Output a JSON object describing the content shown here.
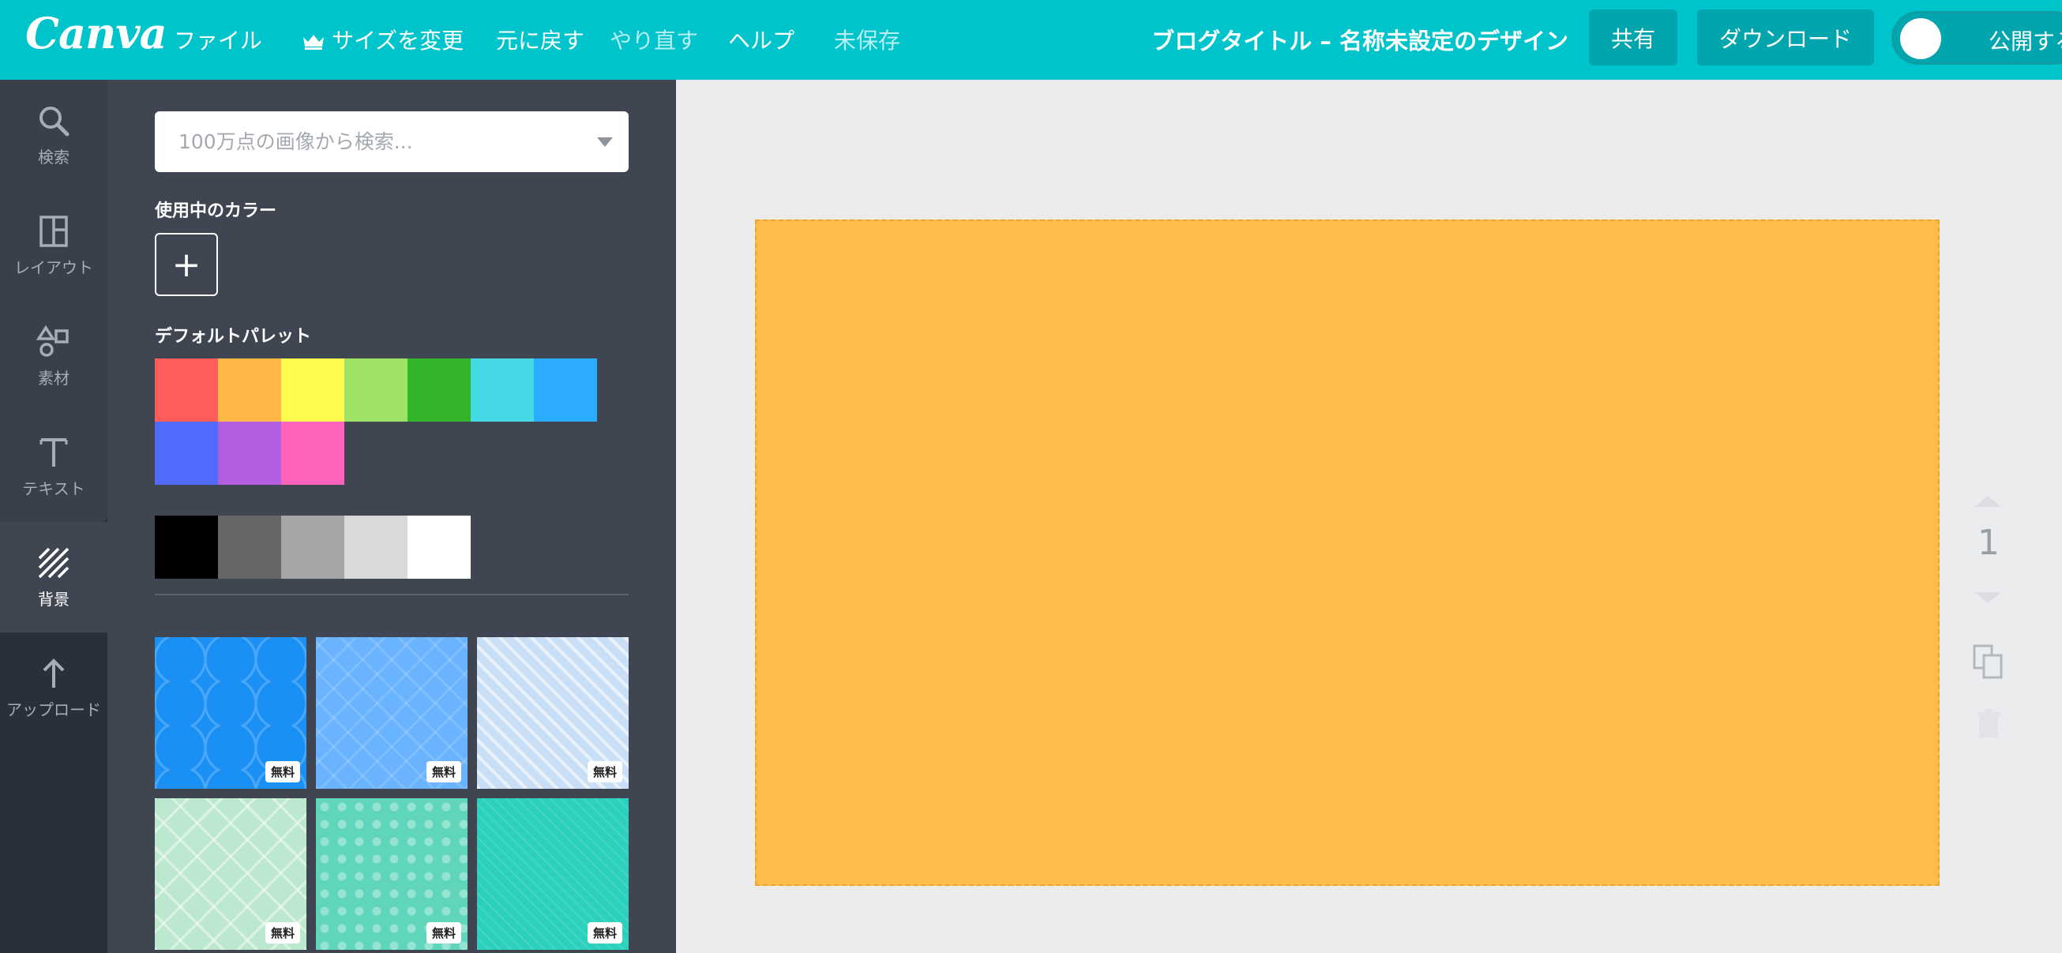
{
  "app": {
    "logo": "Canva"
  },
  "topbar": {
    "file": "ファイル",
    "resize": "サイズを変更",
    "undo": "元に戻す",
    "redo": "やり直す",
    "help": "ヘルプ",
    "save_status": "未保存",
    "doc_title": "ブログタイトル – 名称未設定のデザイン",
    "share": "共有",
    "download": "ダウンロード",
    "publish_toggle": "公開する"
  },
  "rail": {
    "items": [
      {
        "label": "検索",
        "icon": "search-icon"
      },
      {
        "label": "レイアウト",
        "icon": "layout-icon"
      },
      {
        "label": "素材",
        "icon": "elements-icon"
      },
      {
        "label": "テキスト",
        "icon": "text-icon"
      },
      {
        "label": "背景",
        "icon": "background-icon"
      },
      {
        "label": "アップロード",
        "icon": "upload-icon"
      }
    ],
    "active": "背景"
  },
  "panel": {
    "search_placeholder": "100万点の画像から検索...",
    "in_use_label": "使用中のカラー",
    "add_color": "+",
    "default_palette_label": "デフォルトパレット",
    "palette_colors": [
      "#ff5c5c",
      "#ffb845",
      "#fffb4f",
      "#9ee365",
      "#34b42b",
      "#44d9e4",
      "#2bacff",
      "#526bff",
      "#b35de0",
      "#ff63bb"
    ],
    "gray_colors": [
      "#000000",
      "#666666",
      "#a6a6a6",
      "#d9d9d9",
      "#ffffff"
    ],
    "backgrounds": [
      {
        "badge": "無料"
      },
      {
        "badge": "無料"
      },
      {
        "badge": "無料"
      },
      {
        "badge": "無料"
      },
      {
        "badge": "無料"
      },
      {
        "badge": "無料"
      }
    ]
  },
  "canvas": {
    "page_fill": "#febd4b",
    "page_number": "1"
  }
}
